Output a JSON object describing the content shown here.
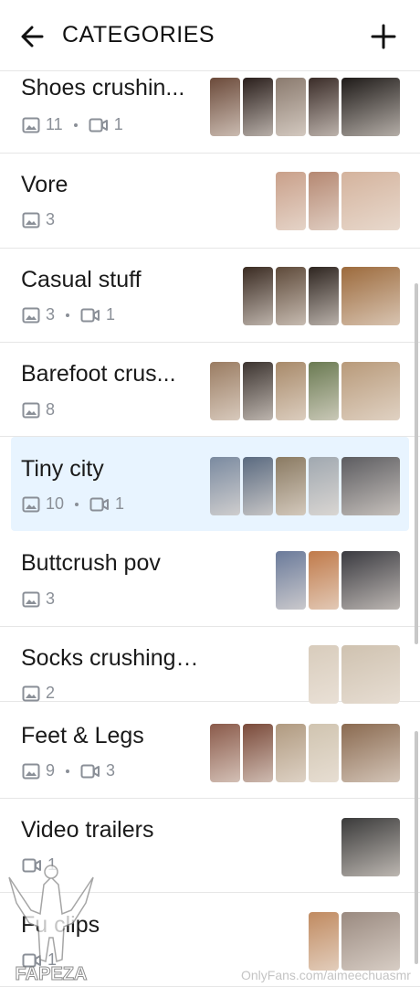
{
  "header": {
    "title": "CATEGORIES",
    "back_icon": "arrow-left-icon",
    "add_icon": "plus-icon"
  },
  "categories": [
    {
      "name": "Shoes crushin...",
      "photos": "11",
      "videos": "1",
      "thumb_colors": [
        "#6b4a3a",
        "#2a1f1c",
        "#8a7a6e",
        "#3a2c28",
        "#1e1a18"
      ]
    },
    {
      "name": "Vore",
      "photos": "3",
      "thumb_colors": [
        "#c9a08a",
        "#b58872",
        "#d4b39d"
      ]
    },
    {
      "name": "Casual stuff",
      "photos": "3",
      "videos": "1",
      "thumb_colors": [
        "#3a2b22",
        "#5e4a3a",
        "#2e2520",
        "#9c6a3c"
      ]
    },
    {
      "name": "Barefoot crus...",
      "photos": "8",
      "thumb_colors": [
        "#9a7c62",
        "#3c3430",
        "#a88a6a",
        "#6a7a52",
        "#b89a7a"
      ]
    },
    {
      "name": "Tiny city",
      "photos": "10",
      "videos": "1",
      "thumb_colors": [
        "#7a8aa0",
        "#5a6a80",
        "#8a7a62",
        "#a0a8b0",
        "#5c5c60"
      ]
    },
    {
      "name": "Buttcrush pov",
      "photos": "3",
      "thumb_colors": [
        "#6a7a9a",
        "#c07a4a",
        "#3a3a40"
      ]
    },
    {
      "name": "Socks crushing pov",
      "photos": "2",
      "thumb_colors": [
        "#d8ccbc",
        "#cfc2b0"
      ]
    },
    {
      "name": "Feet & Legs",
      "photos": "9",
      "videos": "3",
      "thumb_colors": [
        "#8a5a4a",
        "#7a4a3a",
        "#b09a80",
        "#d0c4b0",
        "#8a6a50"
      ]
    },
    {
      "name": "Video trailers",
      "videos": "1",
      "thumb_colors": [
        "#3a3a3a"
      ]
    },
    {
      "name": "Fu   clips",
      "videos": "1",
      "thumb_colors": [
        "#c08a60",
        "#9a8a80"
      ]
    }
  ],
  "icons": {
    "photo": "image-icon",
    "video": "video-camera-icon"
  },
  "watermark": {
    "logo_text": "FAPEZA",
    "credit": "OnlyFans.com/aimeechuasmr"
  },
  "colors": {
    "selected_row": "#e8f4ff",
    "meta_text": "#8a8f97",
    "divider": "#e6e6e6"
  }
}
